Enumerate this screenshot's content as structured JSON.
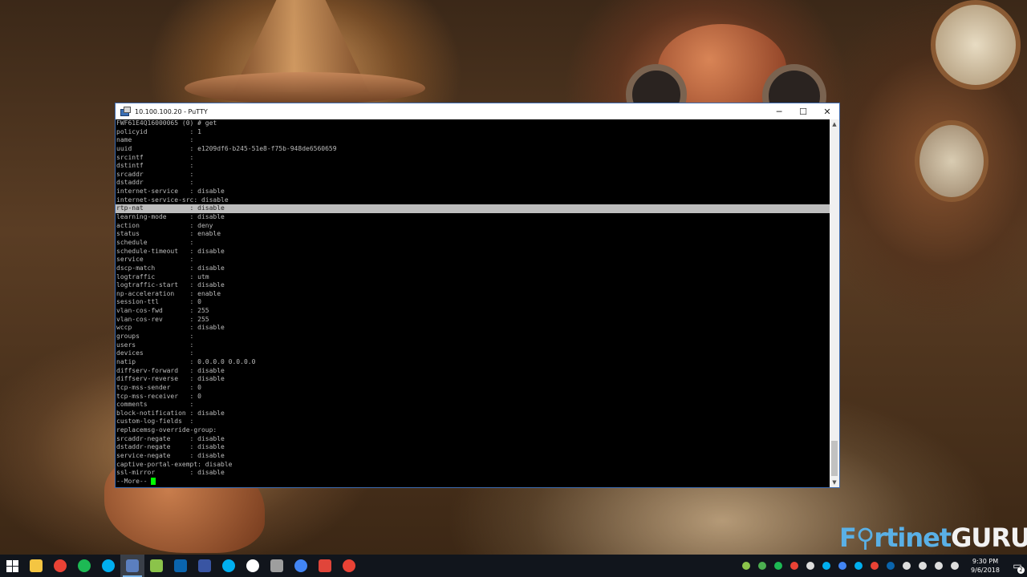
{
  "window": {
    "title": "10.100.100.20 - PuTTY",
    "controls": {
      "minimize": "─",
      "maximize": "☐",
      "close": "✕"
    }
  },
  "terminal": {
    "lines": [
      "FWF61E4Q16000065 (0) # get",
      "policyid           : 1",
      "name               :",
      "uuid               : e1209df6-b245-51e8-f75b-948de6560659",
      "srcintf            :",
      "dstintf            :",
      "srcaddr            :",
      "dstaddr            :",
      "internet-service   : disable",
      "internet-service-src: disable",
      "rtp-nat            : disable",
      "learning-mode      : disable",
      "action             : deny",
      "status             : enable",
      "schedule           :",
      "schedule-timeout   : disable",
      "service            :",
      "dscp-match         : disable",
      "logtraffic         : utm",
      "logtraffic-start   : disable",
      "np-acceleration    : enable",
      "session-ttl        : 0",
      "vlan-cos-fwd       : 255",
      "vlan-cos-rev       : 255",
      "wccp               : disable",
      "groups             :",
      "users              :",
      "devices            :",
      "natip              : 0.0.0.0 0.0.0.0",
      "diffserv-forward   : disable",
      "diffserv-reverse   : disable",
      "tcp-mss-sender     : 0",
      "tcp-mss-receiver   : 0",
      "comments           :",
      "block-notification : disable",
      "custom-log-fields  :",
      "replacemsg-override-group:",
      "srcaddr-negate     : disable",
      "dstaddr-negate     : disable",
      "service-negate     : disable",
      "captive-portal-exempt: disable",
      "ssl-mirror         : disable"
    ],
    "highlighted_line": "rtp-nat            : disable",
    "more_prompt": "--More--"
  },
  "watermark": {
    "part1": "F⚲rtinet",
    "part2": "GURU"
  },
  "taskbar": {
    "apps": [
      {
        "name": "start-button",
        "color": "#ffffff"
      },
      {
        "name": "file-explorer-icon",
        "color": "#f4c542"
      },
      {
        "name": "chrome-icon",
        "color": "#e94235"
      },
      {
        "name": "spotify-icon",
        "color": "#1db954"
      },
      {
        "name": "skype-icon",
        "color": "#00aff0"
      },
      {
        "name": "putty-icon",
        "color": "#5b7fbf"
      },
      {
        "name": "notepad-plus-icon",
        "color": "#8bc34a"
      },
      {
        "name": "outlook-icon",
        "color": "#0a64ad"
      },
      {
        "name": "visio-icon",
        "color": "#3955a3"
      },
      {
        "name": "skype-business-icon",
        "color": "#00aff0"
      },
      {
        "name": "slack-icon",
        "color": "#ffffff"
      },
      {
        "name": "terminal-app-icon",
        "color": "#9e9e9e"
      },
      {
        "name": "chrome-profile-icon",
        "color": "#4285f4"
      },
      {
        "name": "brave-icon",
        "color": "#e0453a"
      },
      {
        "name": "chrome-alt-icon",
        "color": "#e94235"
      }
    ],
    "tray_icons": [
      "#8bc34a",
      "#4caf50",
      "#1db954",
      "#e94235",
      "#dddddd",
      "#00aff0",
      "#4285f4",
      "#00aff0",
      "#e94235",
      "#0a64ad",
      "#dddddd",
      "#dddddd",
      "#dddddd",
      "#dddddd"
    ],
    "clock": {
      "time": "9:30 PM",
      "date": "9/6/2018"
    },
    "notifications": {
      "count": "2"
    }
  }
}
